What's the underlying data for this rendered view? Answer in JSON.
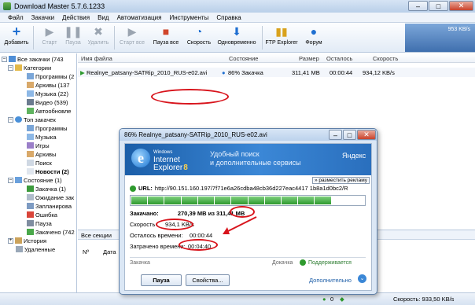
{
  "window": {
    "title": "Download Master 5.7.6.1233",
    "controls": [
      "–",
      "□",
      "✕"
    ]
  },
  "menu": [
    "Файл",
    "Закачки",
    "Действия",
    "Вид",
    "Автоматизация",
    "Инструменты",
    "Справка"
  ],
  "toolbar": {
    "add": "Добавить",
    "start": "Старт",
    "pause": "Пауза",
    "delete": "Удалить",
    "start_all": "Старт все",
    "pause_all": "Пауза все",
    "speed": "Скорость",
    "simultaneous": "Одновременно",
    "ftp": "FTP Explorer",
    "forum": "Форум",
    "speed_box": "953 KB/s"
  },
  "sidebar": {
    "all": "Все закачки (743",
    "categories": "Категории",
    "cat_items": [
      "Программы (2",
      "Архивы (137",
      "Музыка (22)",
      "Видео (539)",
      "Автообновле"
    ],
    "top": "Топ закачек",
    "top_items": [
      "Программы",
      "Музыка",
      "Игры",
      "Архивы",
      "Поиск",
      "Новости (2)"
    ],
    "state": "Состояние (1)",
    "state_items": [
      "Закачка (1)",
      "Ожидание зак",
      "Запланирова",
      "Ошибка",
      "Пауза",
      "Закачено (742"
    ],
    "history": "История",
    "deleted": "Удаленные"
  },
  "table": {
    "headers": [
      "Имя файла",
      "Состояние",
      "Размер",
      "Осталось",
      "Скорость"
    ],
    "row": {
      "name": "Realnye_patsany-SATRip_2010_RUS-e02.avi",
      "state": "86% Закачка",
      "size": "311,41 MB",
      "left": "00:00:44",
      "speed": "934,12 KB/s"
    }
  },
  "bottom": {
    "tab": "Все секции",
    "col_no": "Nº",
    "col_date": "Дата"
  },
  "status": {
    "count": "0",
    "speed": "Скорость: 933,50 KB/s"
  },
  "dialog": {
    "title": "86% Realnye_patsany-SATRip_2010_RUS-e02.avi",
    "ie_windows": "Windows",
    "ie_name1": "Internet",
    "ie_name2": "Explorer",
    "ie_version": "8",
    "ie_slogan1": "Удобный поиск",
    "ie_slogan2": "и дополнительные сервисы",
    "ie_brand": "Яндекс",
    "ad_link": "» разместить рекламу",
    "url_label": "URL:",
    "url": "http://90.151.160.197/7f71e6a26cdba48cb36d227eac4417 1b8a1d0bc2/R",
    "progress_percent": 86,
    "downloaded_label": "Закачано:",
    "downloaded_value": "270,39 MB из",
    "downloaded_total": "311,41 MB",
    "speed_label": "Скорость",
    "speed_value": "934,1 KB/s",
    "remaining_label": "Осталось времени:",
    "remaining_value": "00:00:44",
    "elapsed_label": "Затрачено времени:",
    "elapsed_value": "00:04:40",
    "download_label": "Закачка",
    "resume_label": "Докачка",
    "resume_value": "Поддерживается",
    "pause_btn": "Пауза",
    "props_btn": "Свойства...",
    "more_link": "Дополнительно"
  },
  "colors": {
    "accent": "#3b87d6",
    "progress": "#2e9a2e",
    "annotation": "#d8141c"
  }
}
